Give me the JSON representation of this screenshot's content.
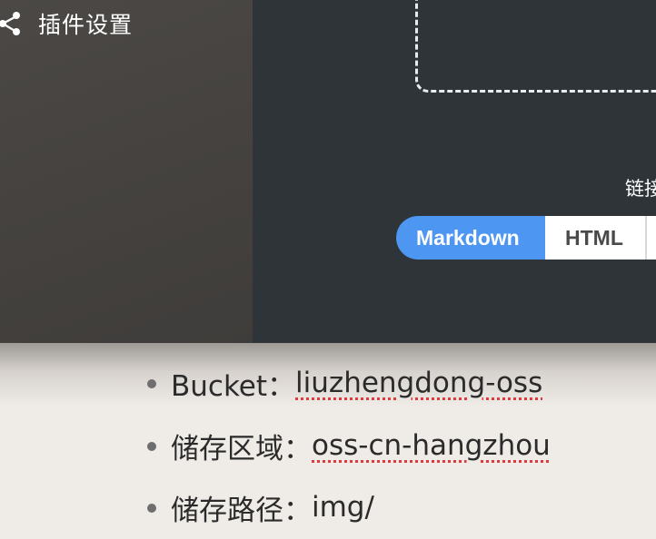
{
  "sidebar": {
    "settings_item": {
      "icon": "share-icon",
      "label": "插件设置"
    }
  },
  "main": {
    "link_label": "链接",
    "format_tabs": [
      {
        "label": "Markdown",
        "selected": true
      },
      {
        "label": "HTML",
        "selected": false
      }
    ],
    "accent_color": "#4d96f2"
  },
  "doc": {
    "items": [
      {
        "key": "Bucket：",
        "value": "liuzhengdong-oss",
        "spell_flag": true
      },
      {
        "key": "储存区域：",
        "value": "oss-cn-hangzhou",
        "spell_flag": true
      },
      {
        "key": "储存路径：",
        "value": "img/",
        "spell_flag": false
      }
    ]
  }
}
